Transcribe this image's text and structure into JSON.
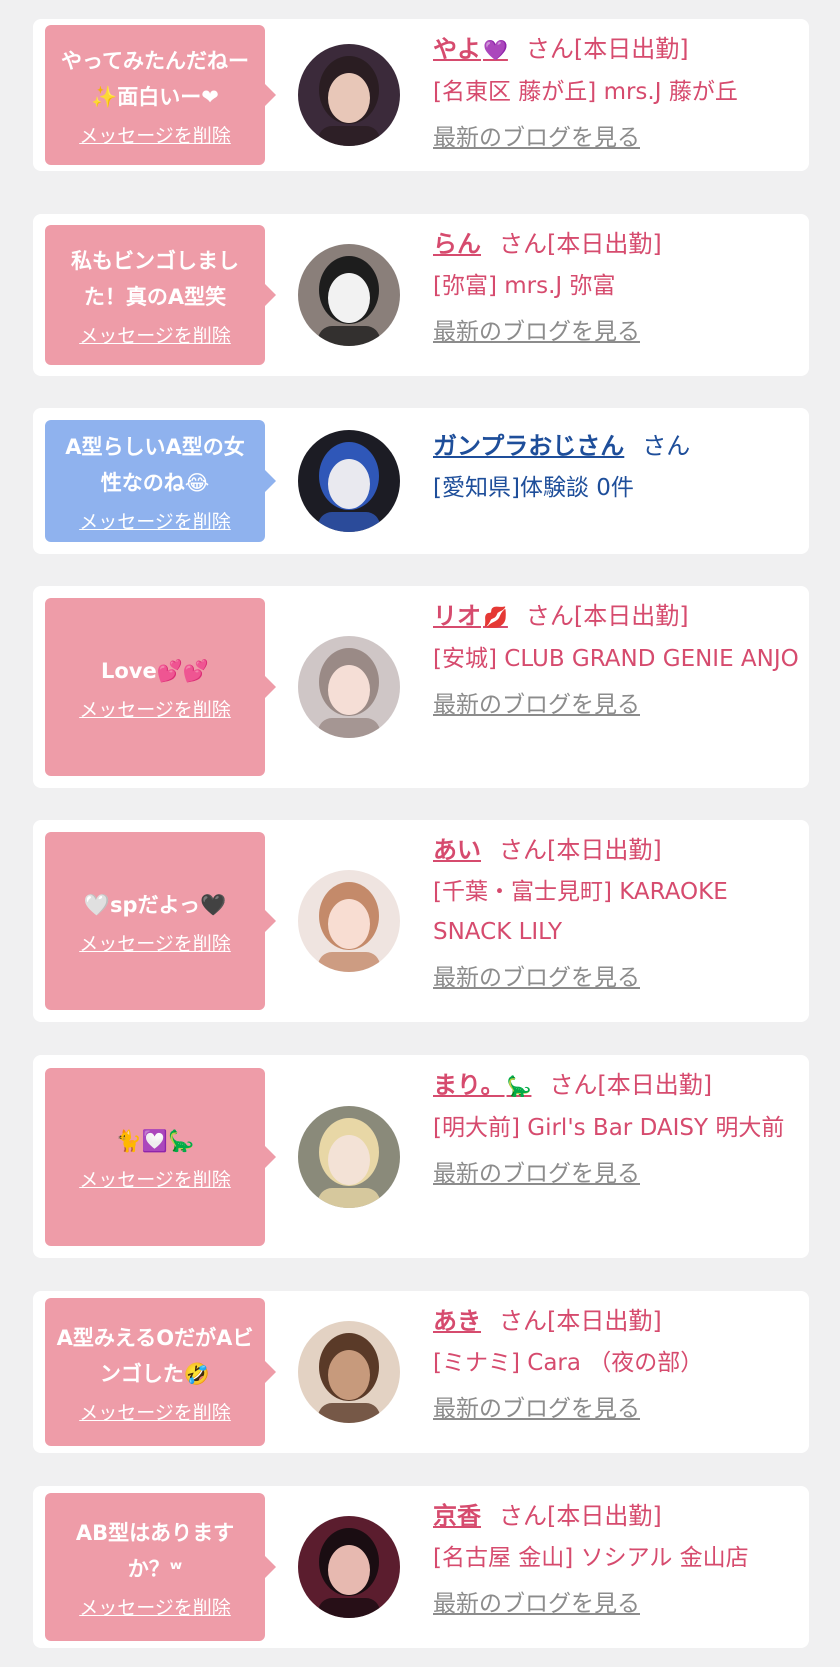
{
  "messages": [
    {
      "message": "やってみたんだねー✨面白いー❤",
      "delete_label": "メッセージを削除",
      "name": "やよ",
      "name_emoji": "💜",
      "suffix": "さん[本日出勤]",
      "shop": "[名東区 藤が丘] mrs.J 藤が丘",
      "blog_label": "最新のブログを見る",
      "theme": "pink",
      "avatar": {
        "bg": "#3b2a3a",
        "face": "#e8c7b8",
        "hair": "#2a1d22"
      }
    },
    {
      "message": "私もビンゴしました！真のA型笑",
      "delete_label": "メッセージを削除",
      "name": "らん",
      "name_emoji": "",
      "suffix": "さん[本日出勤]",
      "shop": "[弥富] mrs.J 弥富",
      "blog_label": "最新のブログを見る",
      "theme": "pink",
      "avatar": {
        "bg": "#8a7f7a",
        "face": "#f2f2f2",
        "hair": "#1d1d1d"
      }
    },
    {
      "message": "A型らしいA型の女性なのね😂",
      "delete_label": "メッセージを削除",
      "name": "ガンプラおじさん",
      "name_emoji": "",
      "suffix": "さん",
      "shop": "[愛知県]体験談 0件",
      "blog_label": "",
      "theme": "blue",
      "avatar": {
        "bg": "#1c1c24",
        "face": "#e9e9ef",
        "hair": "#2f57b8"
      }
    },
    {
      "message": "Love💕💕",
      "delete_label": "メッセージを削除",
      "name": "リオ",
      "name_emoji": "💋",
      "suffix": "さん[本日出勤]",
      "shop": "[安城] CLUB GRAND GENIE ANJO",
      "blog_label": "最新のブログを見る",
      "theme": "pink",
      "avatar": {
        "bg": "#cfc6c6",
        "face": "#f5ded6",
        "hair": "#9a8a86"
      }
    },
    {
      "message": "🤍spだよっ🖤",
      "delete_label": "メッセージを削除",
      "name": "あい",
      "name_emoji": "",
      "suffix": "さん[本日出勤]",
      "shop": "[千葉・富士見町] KARAOKE SNACK LILY",
      "blog_label": "最新のブログを見る",
      "theme": "pink",
      "avatar": {
        "bg": "#efe4e0",
        "face": "#f8ddd2",
        "hair": "#c48a6a"
      }
    },
    {
      "message": "🐈💟🦕",
      "delete_label": "メッセージを削除",
      "name": "まり。",
      "name_emoji": "🦕",
      "suffix": "さん[本日出勤]",
      "shop": "[明大前] Girl's Bar DAISY 明大前",
      "blog_label": "最新のブログを見る",
      "theme": "pink",
      "avatar": {
        "bg": "#8a8a7a",
        "face": "#f3e2d6",
        "hair": "#e8d7a6"
      }
    },
    {
      "message": "A型みえるOだがAビンゴした🤣",
      "delete_label": "メッセージを削除",
      "name": "あき",
      "name_emoji": "",
      "suffix": "さん[本日出勤]",
      "shop": "[ミナミ] Cara （夜の部）",
      "blog_label": "最新のブログを見る",
      "theme": "pink",
      "avatar": {
        "bg": "#e3d2c3",
        "face": "#c79a7c",
        "hair": "#5a3a28"
      }
    },
    {
      "message": "AB型はありますか？ʷ",
      "delete_label": "メッセージを削除",
      "name": "京香",
      "name_emoji": "",
      "suffix": "さん[本日出勤]",
      "shop": "[名古屋 金山] ソシアル 金山店",
      "blog_label": "最新のブログを見る",
      "theme": "pink",
      "avatar": {
        "bg": "#5b1d2e",
        "face": "#e7b9b0",
        "hair": "#1a0d12"
      }
    }
  ]
}
